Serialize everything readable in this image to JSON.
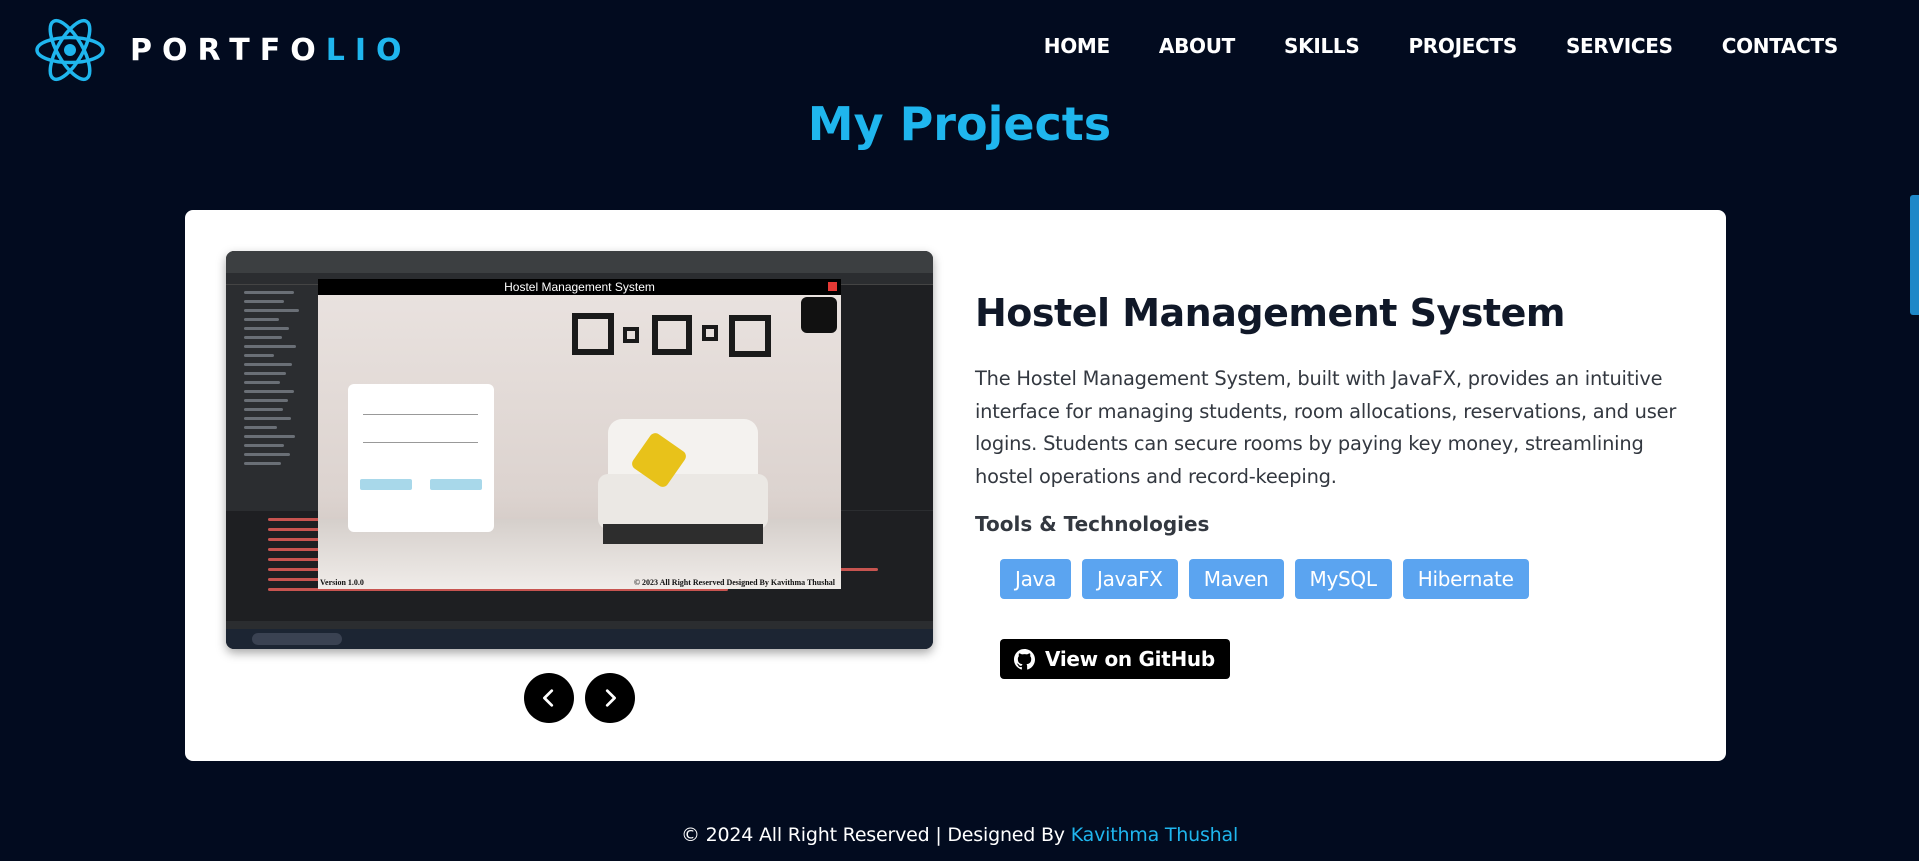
{
  "header": {
    "logo_text_main": "PORTFO",
    "logo_text_accent": "LIO",
    "nav": [
      "HOME",
      "ABOUT",
      "SKILLS",
      "PROJECTS",
      "SERVICES",
      "CONTACTS"
    ]
  },
  "section_title": "My Projects",
  "project": {
    "screenshot": {
      "app_title": "Hostel Management System",
      "footer_left": "Version 1.0.0",
      "footer_right": "© 2023 All Right Reserved Designed By Kavithma Thushal"
    },
    "title": "Hostel Management System",
    "description": "The Hostel Management System, built with JavaFX, provides an intuitive interface for managing students, room allocations, reservations, and user logins. Students can secure rooms by paying key money, streamlining hostel operations and record-keeping.",
    "tools_label": "Tools & Technologies",
    "tools": [
      "Java",
      "JavaFX",
      "Maven",
      "MySQL",
      "Hibernate"
    ],
    "github_label": "View on GitHub"
  },
  "footer": {
    "text": "© 2024 All Right Reserved | Designed By ",
    "author": "Kavithma Thushal"
  },
  "colors": {
    "background": "#020b1f",
    "accent": "#1fb6ee",
    "tag": "#5ba4f0",
    "card": "#ffffff"
  },
  "icons": [
    "react-logo-icon",
    "chevron-left-icon",
    "chevron-right-icon",
    "github-icon"
  ]
}
